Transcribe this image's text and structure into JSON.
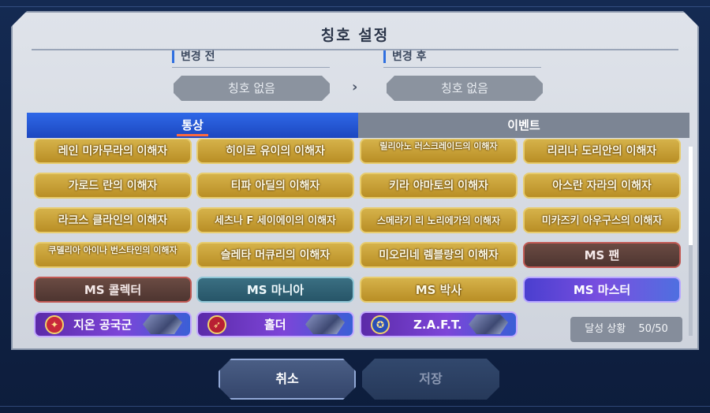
{
  "dialog": {
    "title": "칭호 설정",
    "before_label": "변경 전",
    "after_label": "변경 후",
    "before_value": "칭호 없음",
    "after_value": "칭호 없음",
    "arrow": "›"
  },
  "tabs": [
    {
      "label": "통상",
      "active": true
    },
    {
      "label": "이벤트",
      "active": false
    }
  ],
  "titles": {
    "row1": [
      "레인 미카무라의 이해자",
      "히이로 유이의 이해자",
      "릴리아노 러스크레이드의 이해자",
      "리리나 도리안의 이해자"
    ],
    "row2": [
      "가로드 란의 이해자",
      "티파 아딜의 이해자",
      "키라 야마토의 이해자",
      "아스란 자라의 이해자"
    ],
    "row3": [
      "라크스 클라인의 이해자",
      "세츠나 F 세이에이의 이해자",
      "스메라기 리 노리에가의 이해자",
      "미카즈키 아우구스의 이해자"
    ],
    "row4": [
      "쿠델리아 아이나 번스타인의 이해자",
      "슬레타 머큐리의 이해자",
      "미오리네 렘블랑의 이해자",
      "MS 팬"
    ],
    "row5": [
      "MS 콜렉터",
      "MS 마니아",
      "MS 박사",
      "MS 마스터"
    ],
    "row6": [
      "지온 공국군",
      "홀더",
      "Z.A.F.T."
    ]
  },
  "progress": {
    "label": "달성 상황",
    "value": "50/50"
  },
  "actions": {
    "cancel": "취소",
    "save": "저장"
  },
  "icons": {
    "zeon": "zeon-emblem-icon",
    "holder": "holder-emblem-icon",
    "zaft": "zaft-emblem-icon"
  },
  "colors": {
    "accent": "#2f68e8",
    "gold": "#c9a235",
    "tab_marker": "#ff6a3d"
  }
}
